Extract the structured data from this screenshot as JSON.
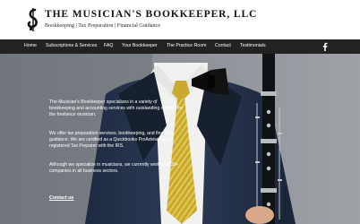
{
  "header": {
    "title": "THE MUSICIAN'S BOOKKEEPER, LLC",
    "tagline": "Bookkeeping | Tax Preparation | Financial Guidance"
  },
  "nav": {
    "items": [
      "Home",
      "Subscriptions & Services",
      "FAQ",
      "Your Bookkeeper",
      "The Practice Room",
      "Contact",
      "Testimonials"
    ],
    "social_icon": "facebook-icon"
  },
  "hero": {
    "paragraphs": [
      "The Musician's Bookkeeper specializes in a variety of bookkeeping and accounting services with outstanding support for the freelance musician.",
      "We offer tax preparation services, bookkeeping, and financial guidance. We are certified as a Quickbooks ProAdvisor and a registered Tax Preparer with the IRS.",
      "Although we specialize in musicians, we currently work with 35+ companies in all business sectors."
    ],
    "link": "Contact us"
  },
  "colors": {
    "nav_bg": "#222222",
    "text_dark": "#111111"
  }
}
